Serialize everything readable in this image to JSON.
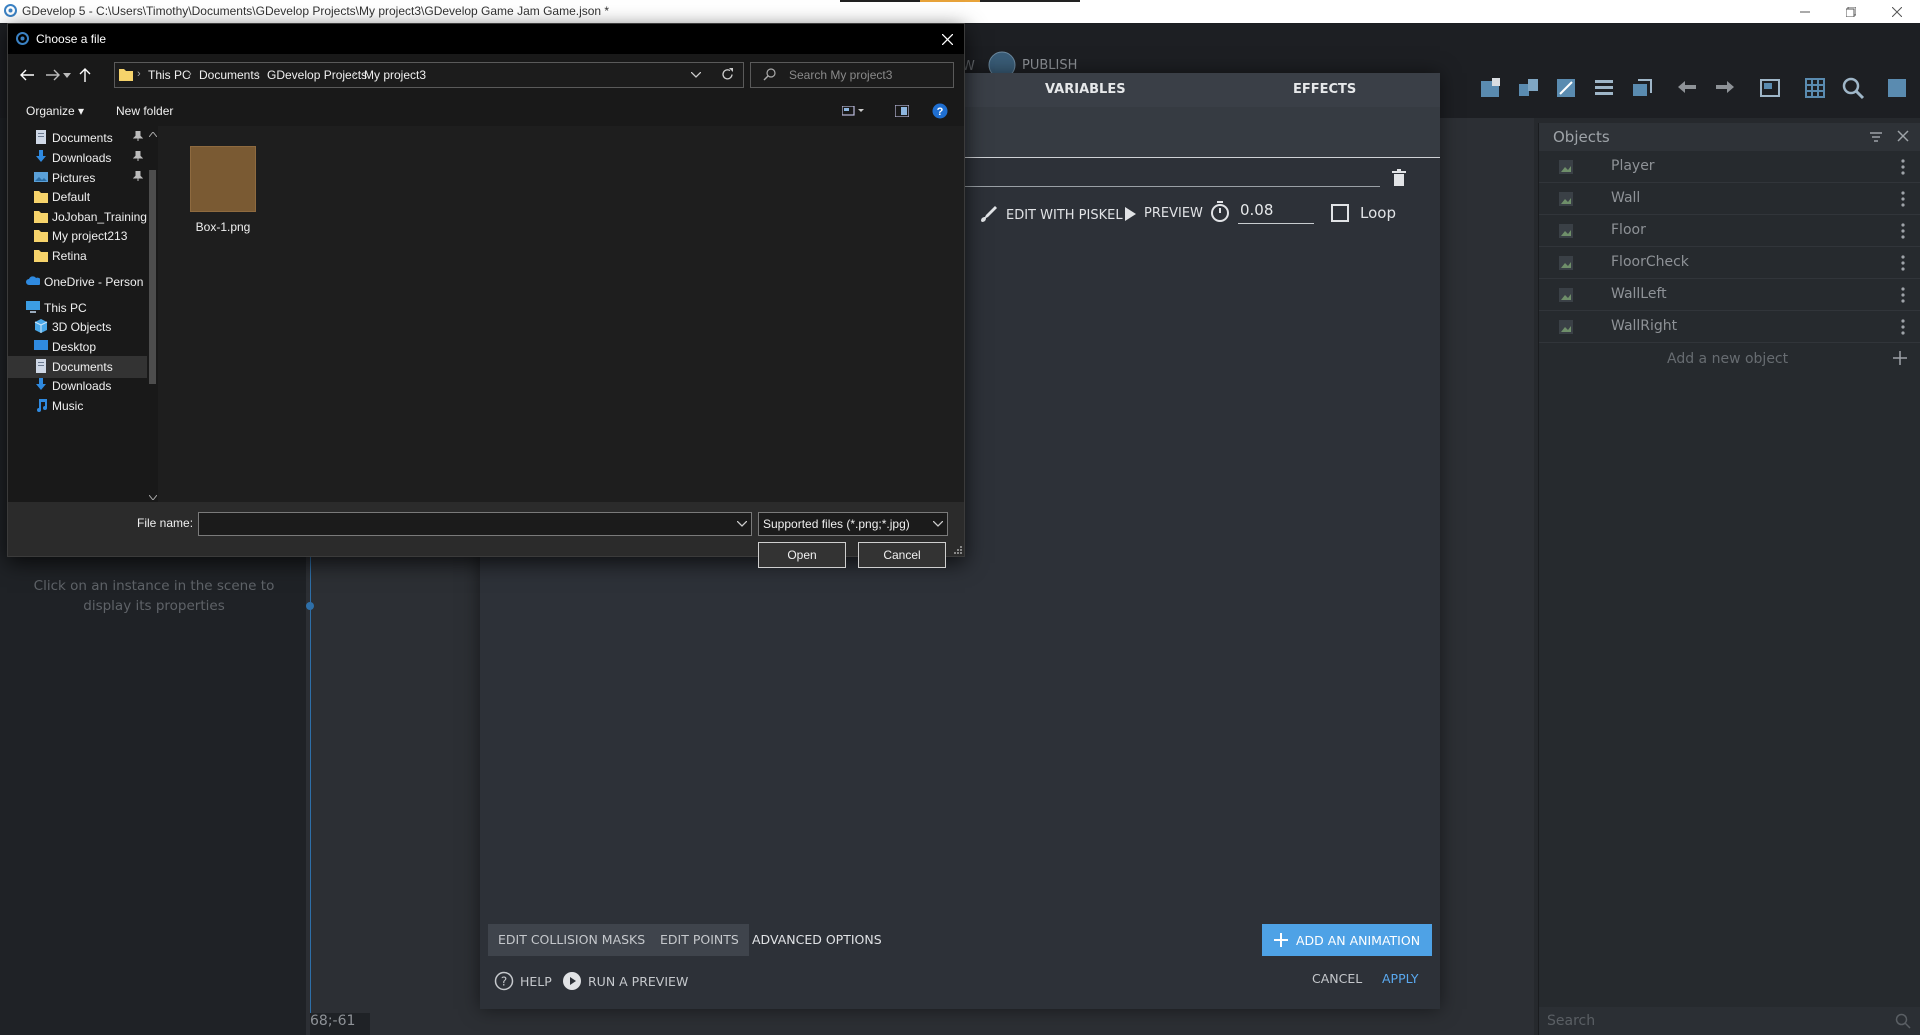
{
  "app": {
    "window_title": "GDevelop 5 - C:\\Users\\Timothy\\Documents\\GDevelop Projects\\My project3\\GDevelop Game Jam Game.json *",
    "toolbar": {
      "publish_label": "PUBLISH",
      "partial_label": "W"
    },
    "instance_hint": "Click on an instance in the scene to display its properties",
    "coordinates": "68;-61",
    "objects_panel": {
      "title": "Objects",
      "items": [
        "Player",
        "Wall",
        "Floor",
        "FloorCheck",
        "WallLeft",
        "WallRight"
      ],
      "add_label": "Add a new object",
      "search_placeholder": "Search"
    }
  },
  "object_editor": {
    "tabs": [
      "VARIABLES",
      "EFFECTS"
    ],
    "edit_with_piskel": "EDIT WITH PISKEL",
    "preview": "PREVIEW",
    "frame_duration": "0.08",
    "loop_label": "Loop",
    "edit_collision_masks": "EDIT COLLISION MASKS",
    "edit_points": "EDIT POINTS",
    "advanced_options": "ADVANCED OPTIONS",
    "add_animation": "ADD AN ANIMATION",
    "help": "HELP",
    "run_preview": "RUN A PREVIEW",
    "cancel": "CANCEL",
    "apply": "APPLY"
  },
  "file_dialog": {
    "title": "Choose a file",
    "breadcrumb": [
      "This PC",
      "Documents",
      "GDevelop Projects",
      "My project3"
    ],
    "search_placeholder": "Search My project3",
    "organize": "Organize",
    "new_folder": "New folder",
    "nav_items": [
      {
        "label": "Documents",
        "icon": "documents-icon",
        "pinned": true
      },
      {
        "label": "Downloads",
        "icon": "downloads-icon",
        "pinned": true
      },
      {
        "label": "Pictures",
        "icon": "pictures-icon",
        "pinned": true
      },
      {
        "label": "Default",
        "icon": "folder-icon",
        "pinned": false
      },
      {
        "label": "JoJoban_Training",
        "icon": "folder-icon",
        "pinned": false
      },
      {
        "label": "My project213",
        "icon": "folder-icon",
        "pinned": false
      },
      {
        "label": "Retina",
        "icon": "folder-icon",
        "pinned": false
      },
      {
        "label": "OneDrive - Person",
        "icon": "onedrive-icon",
        "pinned": false
      },
      {
        "label": "This PC",
        "icon": "pc-icon",
        "pinned": false
      },
      {
        "label": "3D Objects",
        "icon": "3d-objects-icon",
        "pinned": false
      },
      {
        "label": "Desktop",
        "icon": "desktop-icon",
        "pinned": false
      },
      {
        "label": "Documents",
        "icon": "documents-icon",
        "pinned": false
      },
      {
        "label": "Downloads",
        "icon": "downloads-icon",
        "pinned": false
      },
      {
        "label": "Music",
        "icon": "music-icon",
        "pinned": false
      }
    ],
    "files": [
      {
        "name": "Box-1.png",
        "color": "#7a5a33"
      }
    ],
    "file_name_label": "File name:",
    "file_name_value": "",
    "file_type": "Supported files (*.png;*.jpg)",
    "open": "Open",
    "cancel": "Cancel"
  },
  "colors": {
    "accent_blue": "#4ea2e6",
    "apply_blue": "#5aa9ef",
    "folder_yellow": "#f6d36b"
  }
}
